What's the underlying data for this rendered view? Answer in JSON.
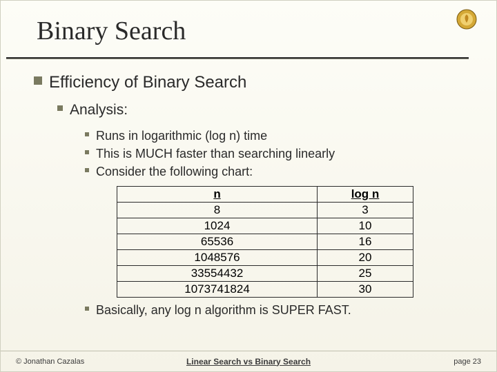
{
  "title": "Binary Search",
  "bullets": {
    "lvl1": "Efficiency of Binary Search",
    "lvl2": "Analysis:",
    "lvl3": [
      "Runs in logarithmic (log n) time",
      "This is MUCH faster than searching linearly",
      "Consider the following chart:"
    ],
    "conclusion": "Basically, any log n algorithm is SUPER FAST."
  },
  "chart_data": {
    "type": "table",
    "columns": [
      "n",
      "log n"
    ],
    "rows": [
      [
        "8",
        "3"
      ],
      [
        "1024",
        "10"
      ],
      [
        "65536",
        "16"
      ],
      [
        "1048576",
        "20"
      ],
      [
        "33554432",
        "25"
      ],
      [
        "1073741824",
        "30"
      ]
    ]
  },
  "footer": {
    "copyright": "© Jonathan Cazalas",
    "center": "Linear Search vs Binary Search",
    "page": "page 23"
  }
}
